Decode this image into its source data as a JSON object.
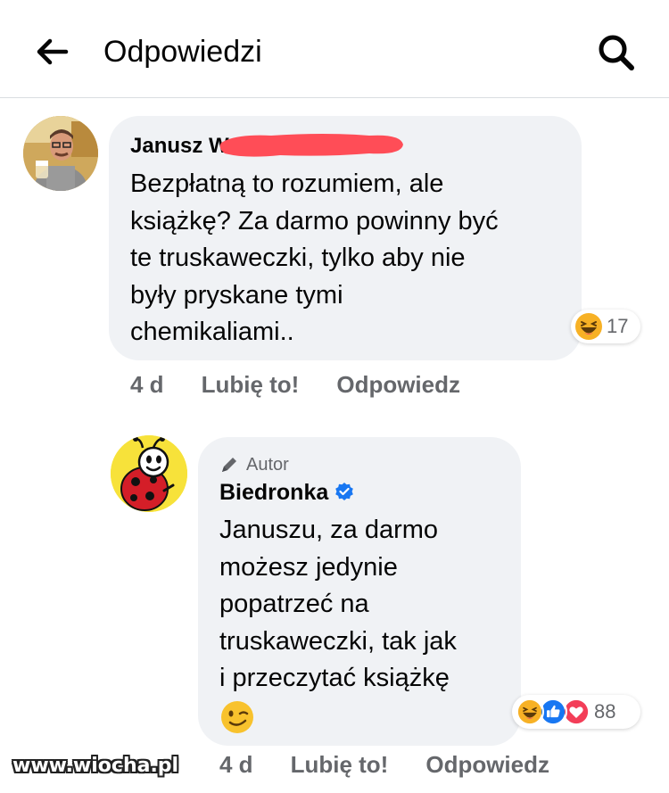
{
  "header": {
    "title": "Odpowiedzi",
    "back_icon": "arrow-left-icon",
    "search_icon": "search-icon"
  },
  "comment_1": {
    "author": "Janusz W",
    "text": "Bezpłatną to rozumiem, ale\nksiążkę? Za darmo powinny być\nte truskaweczki, tylko aby nie\nbyły pryskane tymi\nchemikaliami..",
    "reactions": {
      "icons": [
        "haha"
      ],
      "count": "17"
    },
    "timestamp": "4 d",
    "like_label": "Lubię to!",
    "reply_label": "Odpowiedz"
  },
  "comment_2": {
    "author_tag": "Autor",
    "author": "Biedronka",
    "verified": true,
    "text": "Januszu, za darmo\nmożesz jedynie\npopatrzeć na\ntruskaweczki, tak jak\ni przeczytać książkę",
    "emoji": "wink-emoji",
    "reactions": {
      "icons": [
        "haha",
        "like",
        "love"
      ],
      "count": "88"
    },
    "timestamp": "4 d",
    "like_label": "Lubię to!",
    "reply_label": "Odpowiedz"
  },
  "watermark": "www.wiocha.pl",
  "colors": {
    "bubble": "#f0f2f5",
    "secondary_text": "#65676b",
    "verified_blue": "#1877f2",
    "redaction": "#ff4d57",
    "love_red": "#f33e58",
    "haha_yellow": "#f7b125"
  }
}
